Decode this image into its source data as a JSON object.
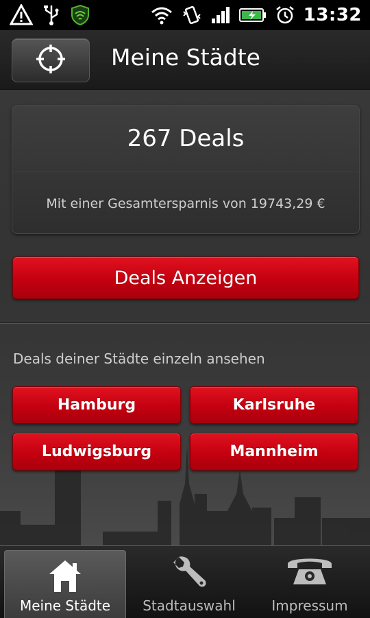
{
  "status_bar": {
    "time": "13:32",
    "icons": [
      "warning-icon",
      "usb-icon",
      "shield-icon",
      "wifi-icon",
      "vibrate-icon",
      "signal-icon",
      "battery-icon",
      "alarm-icon"
    ]
  },
  "header": {
    "title": "Meine Städte",
    "locate_icon": "crosshair-icon"
  },
  "deals": {
    "count_text": "267 Deals",
    "savings_text": "Mit einer Gesamtersparnis von 19743,29 €",
    "show_button": "Deals Anzeigen"
  },
  "cities": {
    "label": "Deals deiner Städte einzeln ansehen",
    "items": [
      "Hamburg",
      "Karlsruhe",
      "Ludwigsburg",
      "Mannheim"
    ]
  },
  "tabs": [
    {
      "label": "Meine Städte",
      "icon": "home-icon",
      "active": true
    },
    {
      "label": "Stadtauswahl",
      "icon": "wrench-icon",
      "active": false
    },
    {
      "label": "Impressum",
      "icon": "phone-icon",
      "active": false
    }
  ],
  "colors": {
    "accent_red": "#c40010",
    "background": "#2f2f2f",
    "status_bar": "#000000"
  }
}
